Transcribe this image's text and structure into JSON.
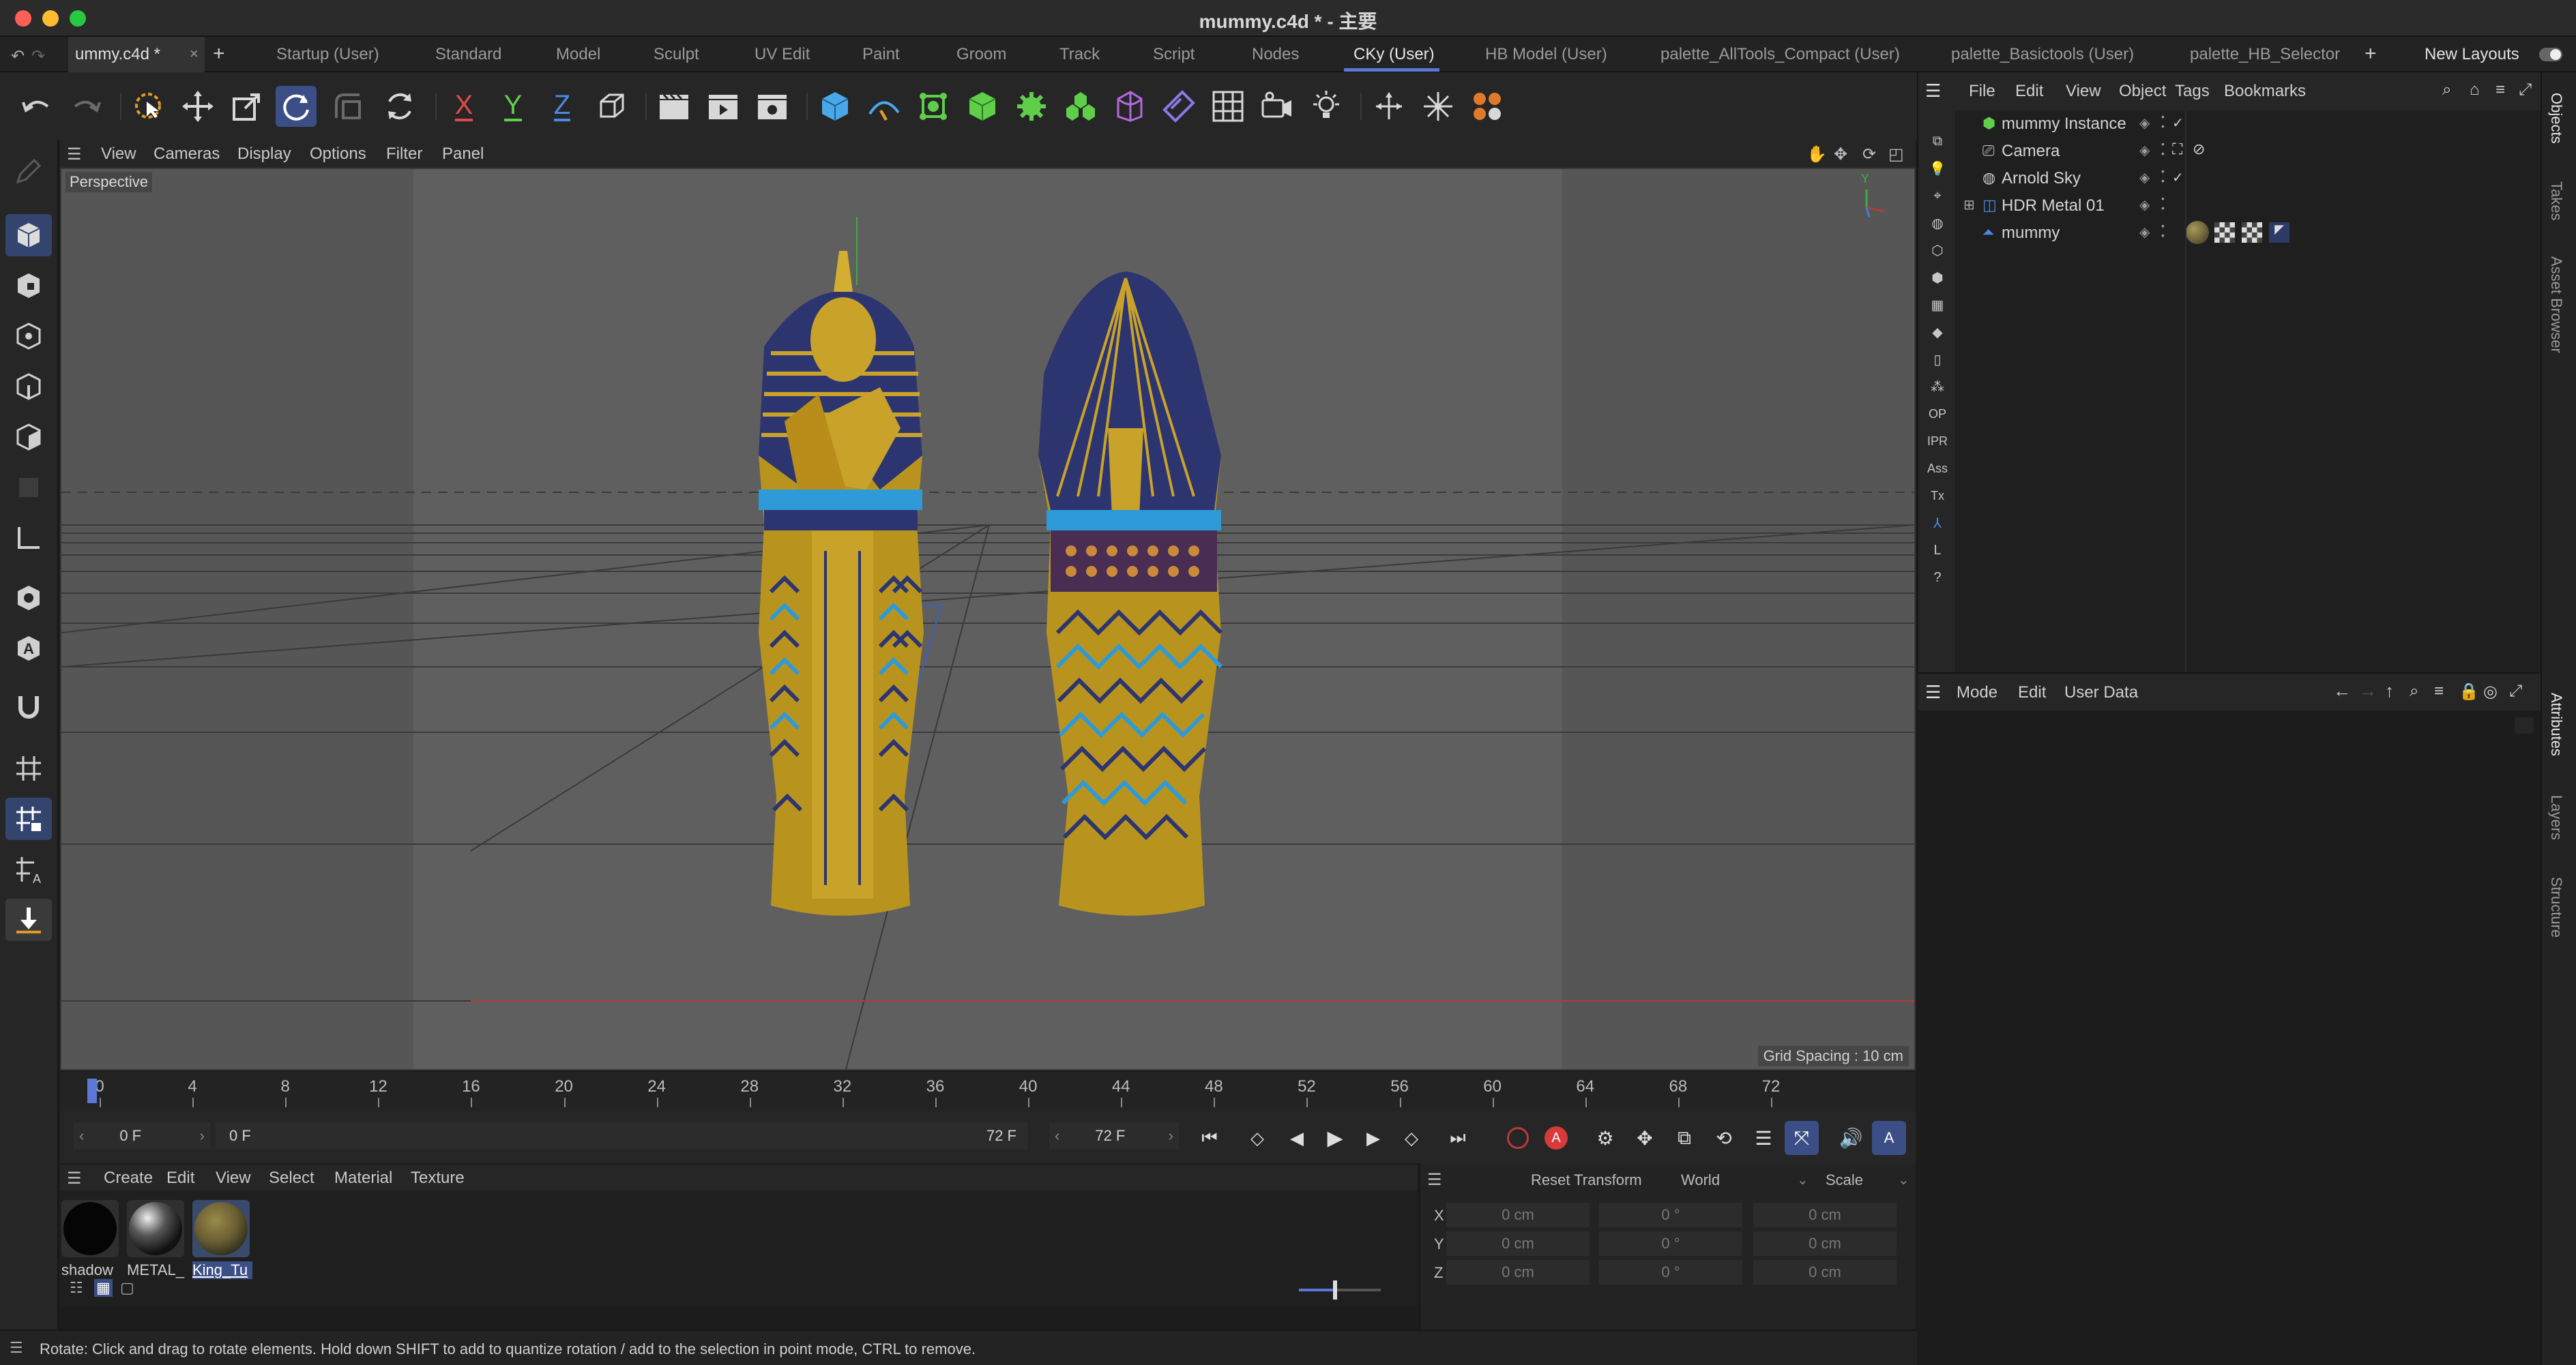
{
  "window": {
    "title": "mummy.c4d * - 主要"
  },
  "layout_tabs": {
    "doc_tab": "ummy.c4d *",
    "items": [
      "Startup (User)",
      "Standard",
      "Model",
      "Sculpt",
      "UV Edit",
      "Paint",
      "Groom",
      "Track",
      "Script",
      "Nodes",
      "CKy (User)",
      "HB Model (User)",
      "palette_AllTools_Compact (User)",
      "palette_Basictools (User)",
      "palette_HB_Selector"
    ],
    "active": "CKy (User)",
    "new_layouts": "New Layouts"
  },
  "toolbar": {
    "axis_x": "X",
    "axis_y": "Y",
    "axis_z": "Z"
  },
  "viewport": {
    "menu": [
      "View",
      "Cameras",
      "Display",
      "Options",
      "Filter",
      "Panel"
    ],
    "camera_label": "Perspective",
    "grid_spacing": "Grid Spacing : 10 cm",
    "axis_y_label": "Y"
  },
  "timeline": {
    "ticks": [
      "0",
      "4",
      "8",
      "12",
      "16",
      "20",
      "24",
      "28",
      "32",
      "36",
      "40",
      "44",
      "48",
      "52",
      "56",
      "60",
      "64",
      "68",
      "72"
    ],
    "current_frame": "0 F",
    "range_start": "0 F",
    "range_end": "72 F",
    "max_frame": "72 F"
  },
  "materials": {
    "menu": [
      "Create",
      "Edit",
      "View",
      "Select",
      "Material",
      "Texture"
    ],
    "items": [
      {
        "name": "shadow",
        "color": "#050505"
      },
      {
        "name": "METAL_",
        "color": "#202020"
      },
      {
        "name": "King_Tu",
        "color": "#6b5e34"
      }
    ]
  },
  "coordinates": {
    "reset_button": "Reset Transform",
    "space": "World",
    "mode": "Scale",
    "rows": [
      {
        "axis": "X",
        "pos": "0 cm",
        "rot": "0 °",
        "size": "0 cm"
      },
      {
        "axis": "Y",
        "pos": "0 cm",
        "rot": "0 °",
        "size": "0 cm"
      },
      {
        "axis": "Z",
        "pos": "0 cm",
        "rot": "0 °",
        "size": "0 cm"
      }
    ]
  },
  "status": {
    "text": "Rotate: Click and drag to rotate elements. Hold down SHIFT to add to quantize rotation / add to the selection in point mode, CTRL to remove."
  },
  "objects": {
    "menu": [
      "File",
      "Edit",
      "View",
      "Object",
      "Tags",
      "Bookmarks"
    ],
    "items": [
      {
        "name": "mummy Instance"
      },
      {
        "name": "Camera"
      },
      {
        "name": "Arnold Sky"
      },
      {
        "name": "HDR Metal 01"
      },
      {
        "name": "mummy"
      }
    ]
  },
  "right_strip_labels": [
    "OP",
    "IPR",
    "Ass",
    "Tx",
    "L",
    "?"
  ],
  "attributes": {
    "menu": [
      "Mode",
      "Edit",
      "User Data"
    ]
  },
  "side_tabs": [
    "Objects",
    "Takes",
    "Asset Browser",
    "Attributes",
    "Layers",
    "Structure"
  ],
  "colors": {
    "accent": "#5b78d8",
    "selected_tool": "#3b4f86",
    "gold": "#c9a22a",
    "lapis": "#2d3570",
    "turquoise": "#2e9ad8"
  }
}
